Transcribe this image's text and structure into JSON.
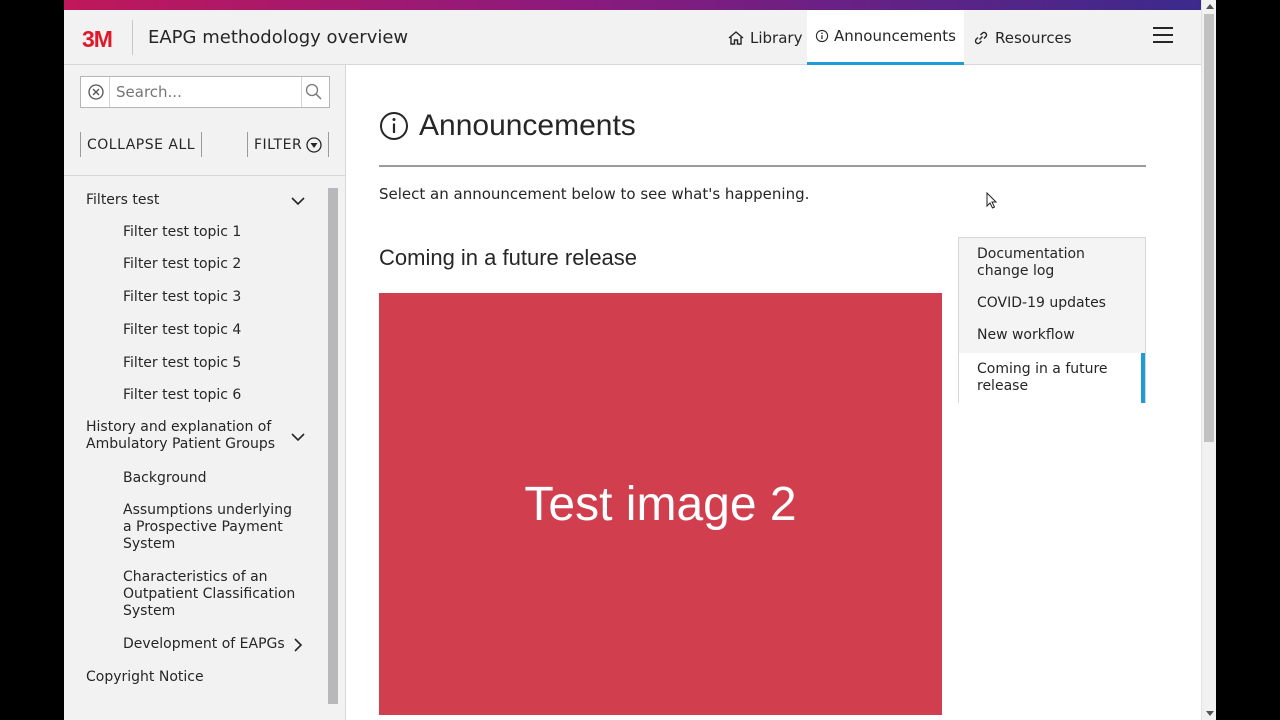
{
  "header": {
    "logo": "3M",
    "title": "EAPG methodology overview",
    "nav": [
      {
        "label": "Library",
        "icon": "home-icon"
      },
      {
        "label": "Announcements",
        "icon": "info-icon",
        "active": true
      },
      {
        "label": "Resources",
        "icon": "link-icon"
      }
    ],
    "menu_icon": "hamburger-menu-icon",
    "accent_color": "#1e9bd7"
  },
  "sidebar": {
    "search_placeholder": "Search...",
    "collapse_label": "COLLAPSE ALL",
    "filter_label": "FILTER",
    "tree": [
      {
        "label": "Filters test",
        "level": 1,
        "expanded": true
      },
      {
        "label": "Filter test topic 1",
        "level": 2
      },
      {
        "label": "Filter test topic 2",
        "level": 2
      },
      {
        "label": "Filter test topic 3",
        "level": 2
      },
      {
        "label": "Filter test topic 4",
        "level": 2
      },
      {
        "label": "Filter test topic 5",
        "level": 2
      },
      {
        "label": "Filter test topic 6",
        "level": 2
      },
      {
        "label": "History and explanation of Ambulatory Patient Groups",
        "level": 1,
        "expanded": true
      },
      {
        "label": "Background",
        "level": 2
      },
      {
        "label": "Assumptions underlying a Prospective Payment System",
        "level": 2
      },
      {
        "label": "Characteristics of an Outpatient Classification System",
        "level": 2
      },
      {
        "label": "Development of EAPGs",
        "level": 2,
        "expanded": false
      },
      {
        "label": "Copyright Notice",
        "level": 1
      }
    ]
  },
  "main": {
    "title": "Announcements",
    "intro": "Select an announcement below to see what's happening.",
    "section_title": "Coming in a future release",
    "image_text": "Test image 2",
    "image_color": "#d13f4e",
    "toc": [
      {
        "label": "Documentation change log"
      },
      {
        "label": "COVID-19 updates"
      },
      {
        "label": "New workflow"
      },
      {
        "label": "Coming in a future release",
        "active": true
      }
    ]
  }
}
